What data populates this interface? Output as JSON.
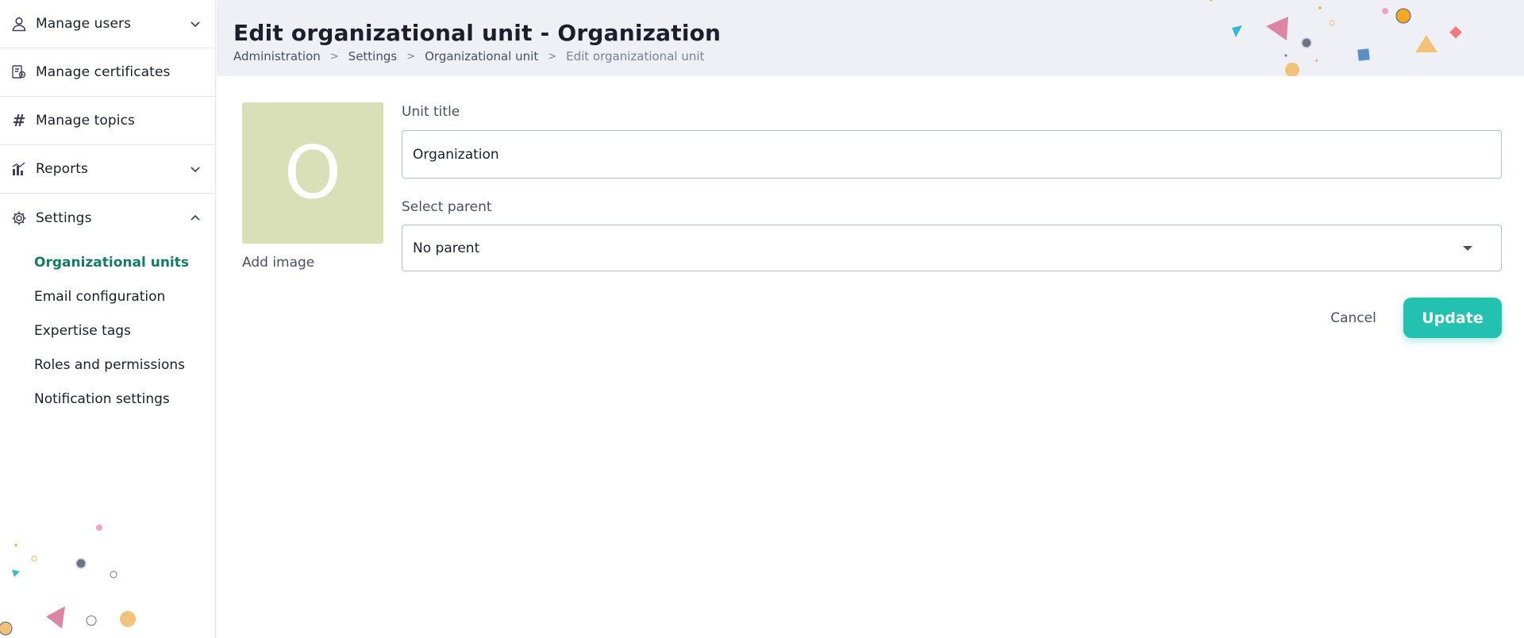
{
  "sidebar": {
    "items": [
      {
        "label": "Manage users",
        "icon": "user-icon",
        "chevron": "down"
      },
      {
        "label": "Manage certificates",
        "icon": "certificate-icon"
      },
      {
        "label": "Manage topics",
        "icon": "hash-icon"
      },
      {
        "label": "Reports",
        "icon": "reports-icon",
        "chevron": "down"
      },
      {
        "label": "Settings",
        "icon": "gear-icon",
        "chevron": "up"
      }
    ],
    "settings_sub": [
      {
        "label": "Organizational units",
        "active": true
      },
      {
        "label": "Email configuration"
      },
      {
        "label": "Expertise tags"
      },
      {
        "label": "Roles and permissions"
      },
      {
        "label": "Notification settings"
      }
    ]
  },
  "header": {
    "title": "Edit organizational unit - Organization",
    "breadcrumb": [
      "Administration",
      "Settings",
      "Organizational unit",
      "Edit organizational unit"
    ],
    "separator": ">"
  },
  "form": {
    "avatar_letter": "O",
    "add_image_label": "Add image",
    "unit_title_label": "Unit title",
    "unit_title_value": "Organization",
    "parent_label": "Select parent",
    "parent_value": "No parent",
    "cancel_label": "Cancel",
    "update_label": "Update"
  },
  "colors": {
    "accent": "#22c1b0",
    "active_link": "#157a68",
    "avatar_bg": "#d9dfb7",
    "header_bg": "#eef0f6"
  }
}
